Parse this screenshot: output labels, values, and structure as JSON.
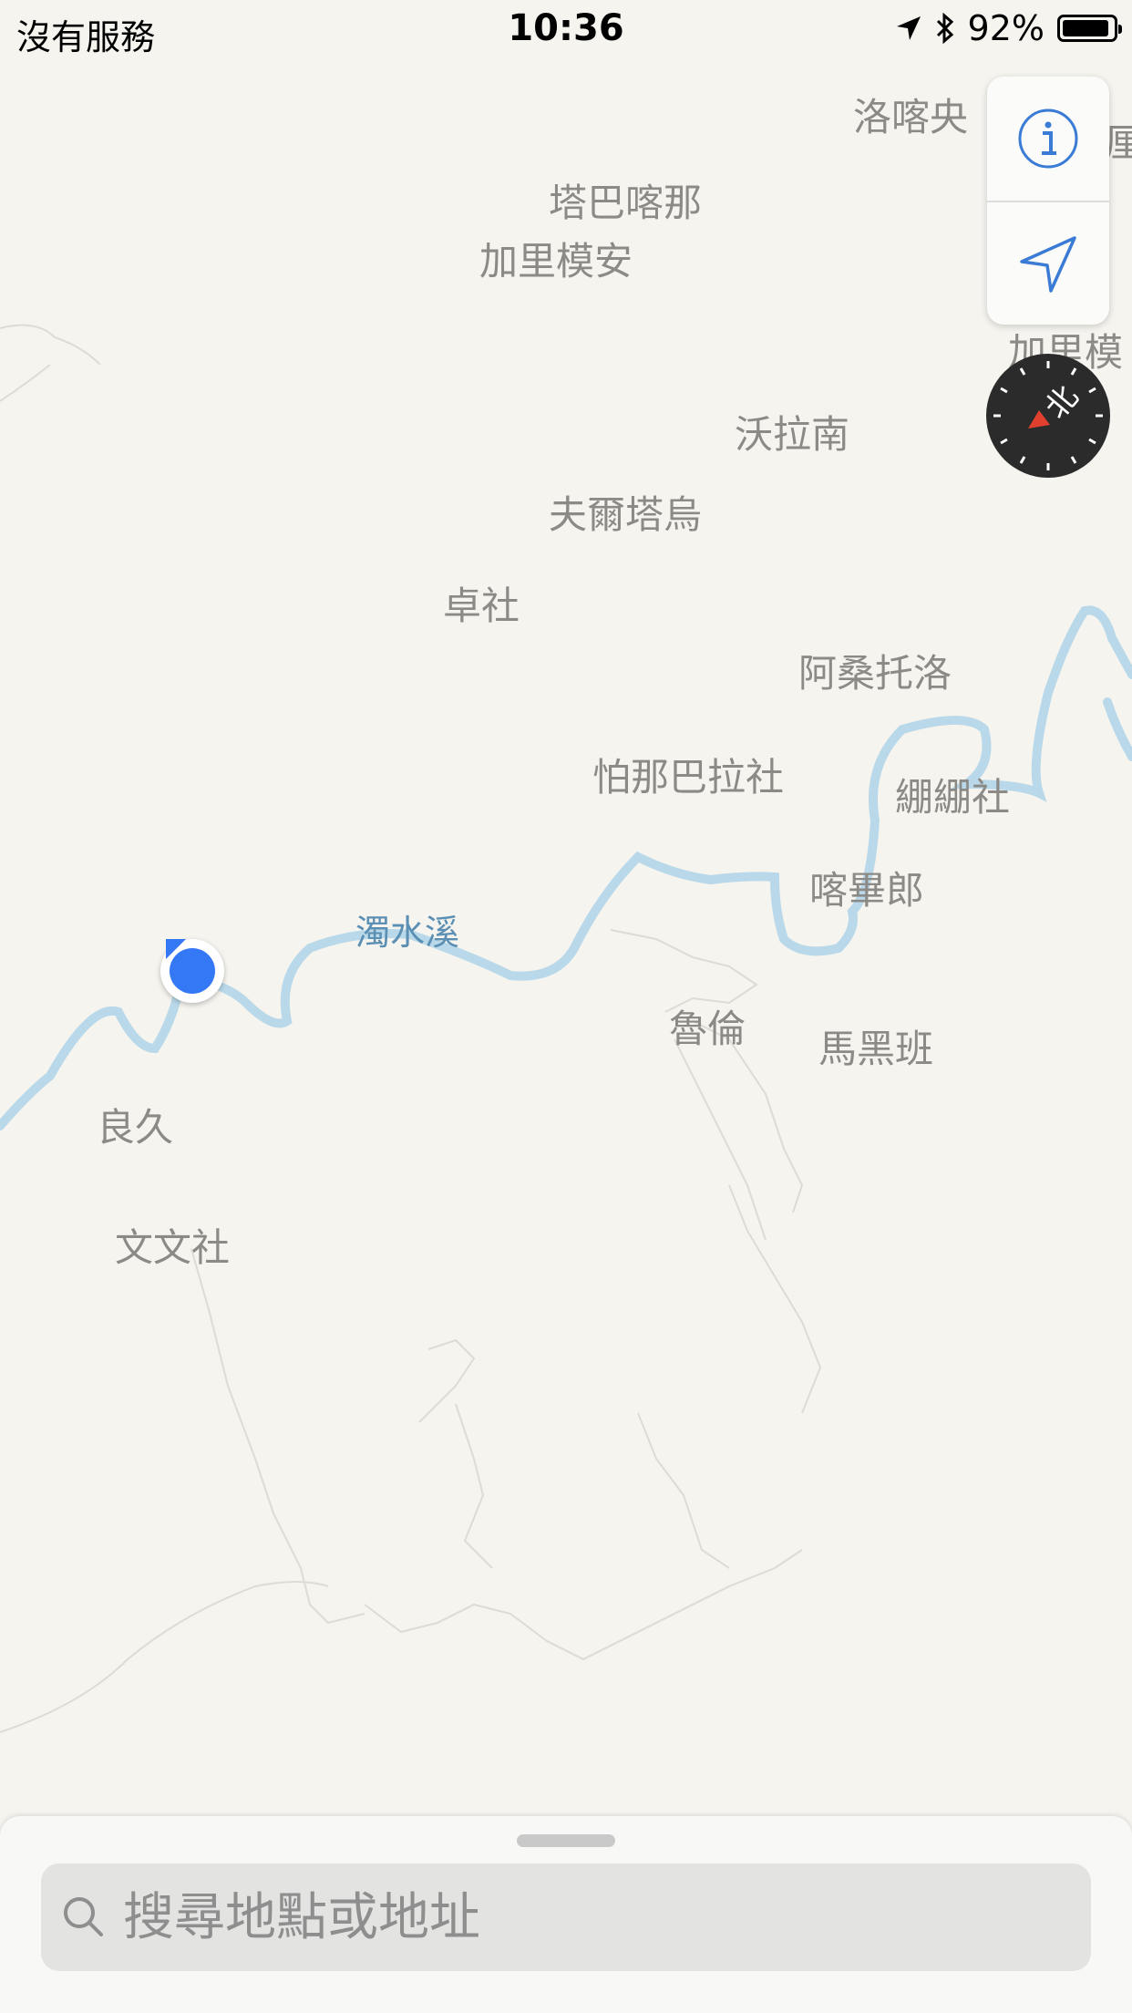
{
  "status_bar": {
    "carrier": "沒有服務",
    "time": "10:36",
    "battery": "92%",
    "battery_level": 0.92
  },
  "map": {
    "places": [
      {
        "id": "p1",
        "name": "洛喀央"
      },
      {
        "id": "p2",
        "name": "塔巴喀那"
      },
      {
        "id": "p3",
        "name": "加里模安"
      },
      {
        "id": "p4",
        "name": "加里模"
      },
      {
        "id": "p5",
        "name": "沃拉南"
      },
      {
        "id": "p6",
        "name": "夫爾塔烏"
      },
      {
        "id": "p7",
        "name": "卓社"
      },
      {
        "id": "p8",
        "name": "阿桑托洛"
      },
      {
        "id": "p9",
        "name": "怕那巴拉社"
      },
      {
        "id": "p10",
        "name": "綳綳社"
      },
      {
        "id": "p11",
        "name": "喀畢郎"
      },
      {
        "id": "p12",
        "name": "魯倫"
      },
      {
        "id": "p13",
        "name": "馬黑班"
      },
      {
        "id": "p14",
        "name": "良久"
      },
      {
        "id": "p15",
        "name": "文文社"
      },
      {
        "id": "p16",
        "name": "厘"
      }
    ],
    "river_label": "濁水溪",
    "colors": {
      "background": "#f6f4ef",
      "river": "#b9d9ea",
      "user_dot": "#3478f6"
    }
  },
  "controls": {
    "info_icon": "info-icon",
    "location_icon": "location-arrow-icon",
    "compass_icon": "compass-icon"
  },
  "search": {
    "placeholder": "搜尋地點或地址",
    "icon": "search-icon"
  }
}
